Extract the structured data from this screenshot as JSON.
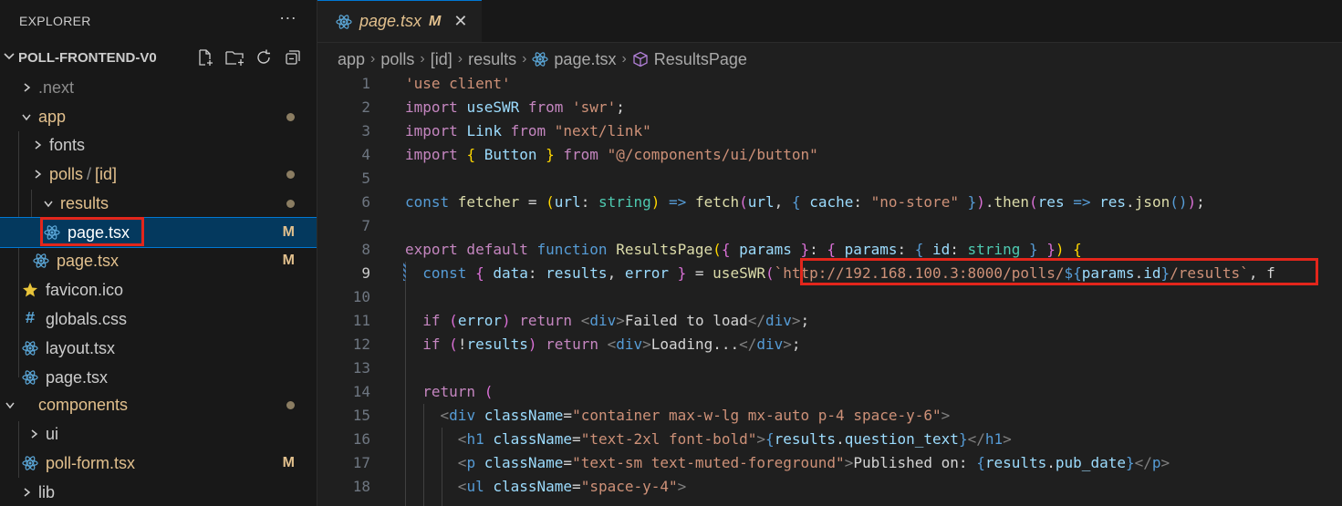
{
  "explorer": {
    "title": "EXPLORER",
    "more": "···",
    "project": "POLL-FRONTEND-V0",
    "tree": [
      {
        "label": ".next",
        "depth": 0,
        "kind": "folder",
        "open": false,
        "status": ""
      },
      {
        "label": "app",
        "depth": 0,
        "kind": "folder",
        "open": true,
        "status": "dot"
      },
      {
        "label": "fonts",
        "depth": 1,
        "kind": "folder",
        "open": false,
        "status": ""
      },
      {
        "label": "polls",
        "label2": "[id]",
        "depth": 1,
        "kind": "folder",
        "open": false,
        "status": "dot"
      },
      {
        "label": "results",
        "depth": 2,
        "kind": "folder",
        "open": true,
        "status": "dot"
      },
      {
        "label": "page.tsx",
        "depth": 3,
        "kind": "react",
        "status": "M",
        "selected": true
      },
      {
        "label": "page.tsx",
        "depth": 2,
        "kind": "react",
        "status": "M"
      },
      {
        "label": "favicon.ico",
        "depth": 1,
        "kind": "star",
        "status": ""
      },
      {
        "label": "globals.css",
        "depth": 1,
        "kind": "hash",
        "status": ""
      },
      {
        "label": "layout.tsx",
        "depth": 1,
        "kind": "react",
        "status": ""
      },
      {
        "label": "page.tsx",
        "depth": 1,
        "kind": "react",
        "status": ""
      },
      {
        "label": "components",
        "depth": 0,
        "kind": "folder",
        "open": true,
        "status": "dot"
      },
      {
        "label": "ui",
        "depth": 1,
        "kind": "folder",
        "open": false,
        "status": ""
      },
      {
        "label": "poll-form.tsx",
        "depth": 1,
        "kind": "react",
        "status": "M"
      },
      {
        "label": "lib",
        "depth": 0,
        "kind": "folder",
        "open": false,
        "status": ""
      }
    ]
  },
  "tab": {
    "label": "page.tsx",
    "modified": "M",
    "close": "✕"
  },
  "breadcrumb": [
    "app",
    "polls",
    "[id]",
    "results",
    "page.tsx",
    "ResultsPage"
  ],
  "code": {
    "current_line": 9,
    "lines": [
      [
        [
          "s",
          "'use client'"
        ]
      ],
      [
        [
          "k",
          "import "
        ],
        [
          "v",
          "useSWR"
        ],
        [
          "k",
          " from "
        ],
        [
          "s",
          "'swr'"
        ],
        [
          "p",
          ";"
        ]
      ],
      [
        [
          "k",
          "import "
        ],
        [
          "v",
          "Link"
        ],
        [
          "k",
          " from "
        ],
        [
          "s",
          "\"next/link\""
        ]
      ],
      [
        [
          "k",
          "import "
        ],
        [
          "y",
          "{ "
        ],
        [
          "v",
          "Button"
        ],
        [
          "y",
          " }"
        ],
        [
          "k",
          " from "
        ],
        [
          "s",
          "\"@/components/ui/button\""
        ]
      ],
      [],
      [
        [
          "b",
          "const "
        ],
        [
          "f",
          "fetcher"
        ],
        [
          "p",
          " = "
        ],
        [
          "y",
          "("
        ],
        [
          "v",
          "url"
        ],
        [
          "p",
          ": "
        ],
        [
          "t",
          "string"
        ],
        [
          "y",
          ")"
        ],
        [
          "p",
          " "
        ],
        [
          "b",
          "=>"
        ],
        [
          "p",
          " "
        ],
        [
          "f",
          "fetch"
        ],
        [
          "m",
          "("
        ],
        [
          "v",
          "url"
        ],
        [
          "p",
          ", "
        ],
        [
          "b",
          "{ "
        ],
        [
          "v",
          "cache"
        ],
        [
          "p",
          ": "
        ],
        [
          "s",
          "\"no-store\""
        ],
        [
          "b",
          " }"
        ],
        [
          "m",
          ")"
        ],
        [
          "p",
          "."
        ],
        [
          "f",
          "then"
        ],
        [
          "m",
          "("
        ],
        [
          "v",
          "res"
        ],
        [
          "p",
          " "
        ],
        [
          "b",
          "=>"
        ],
        [
          "p",
          " "
        ],
        [
          "v",
          "res"
        ],
        [
          "p",
          "."
        ],
        [
          "f",
          "json"
        ],
        [
          "b",
          "()"
        ],
        [
          "m",
          ")"
        ],
        [
          "p",
          ";"
        ]
      ],
      [],
      [
        [
          "k",
          "export default "
        ],
        [
          "b",
          "function "
        ],
        [
          "f",
          "ResultsPage"
        ],
        [
          "y",
          "("
        ],
        [
          "m",
          "{ "
        ],
        [
          "v",
          "params"
        ],
        [
          "m",
          " }"
        ],
        [
          "p",
          ": "
        ],
        [
          "m",
          "{ "
        ],
        [
          "v",
          "params"
        ],
        [
          "p",
          ": "
        ],
        [
          "b",
          "{ "
        ],
        [
          "v",
          "id"
        ],
        [
          "p",
          ": "
        ],
        [
          "t",
          "string"
        ],
        [
          "b",
          " }"
        ],
        [
          "m",
          " }"
        ],
        [
          "y",
          ")"
        ],
        [
          "p",
          " "
        ],
        [
          "y",
          "{"
        ]
      ],
      [
        [
          "p",
          "  "
        ],
        [
          "b",
          "const "
        ],
        [
          "m",
          "{ "
        ],
        [
          "v",
          "data"
        ],
        [
          "p",
          ": "
        ],
        [
          "v",
          "results"
        ],
        [
          "p",
          ", "
        ],
        [
          "v",
          "error"
        ],
        [
          "m",
          " }"
        ],
        [
          "p",
          " = "
        ],
        [
          "f",
          "useSWR"
        ],
        [
          "m",
          "("
        ],
        [
          "s",
          "`http://192.168.100.3:8000/polls/"
        ],
        [
          "b",
          "${"
        ],
        [
          "v",
          "params"
        ],
        [
          "p",
          "."
        ],
        [
          "v",
          "id"
        ],
        [
          "b",
          "}"
        ],
        [
          "s",
          "/results`"
        ],
        [
          "p",
          ", f"
        ]
      ],
      [],
      [
        [
          "p",
          "  "
        ],
        [
          "k",
          "if "
        ],
        [
          "m",
          "("
        ],
        [
          "v",
          "error"
        ],
        [
          "m",
          ")"
        ],
        [
          "k",
          " return "
        ],
        [
          "g",
          "<"
        ],
        [
          "tag",
          "div"
        ],
        [
          "g",
          ">"
        ],
        [
          "p",
          "Failed to load"
        ],
        [
          "g",
          "</"
        ],
        [
          "tag",
          "div"
        ],
        [
          "g",
          ">"
        ],
        [
          "p",
          ";"
        ]
      ],
      [
        [
          "p",
          "  "
        ],
        [
          "k",
          "if "
        ],
        [
          "m",
          "("
        ],
        [
          "p",
          "!"
        ],
        [
          "v",
          "results"
        ],
        [
          "m",
          ")"
        ],
        [
          "k",
          " return "
        ],
        [
          "g",
          "<"
        ],
        [
          "tag",
          "div"
        ],
        [
          "g",
          ">"
        ],
        [
          "p",
          "Loading..."
        ],
        [
          "g",
          "</"
        ],
        [
          "tag",
          "div"
        ],
        [
          "g",
          ">"
        ],
        [
          "p",
          ";"
        ]
      ],
      [],
      [
        [
          "p",
          "  "
        ],
        [
          "k",
          "return "
        ],
        [
          "m",
          "("
        ]
      ],
      [
        [
          "p",
          "    "
        ],
        [
          "g",
          "<"
        ],
        [
          "tag",
          "div"
        ],
        [
          "p",
          " "
        ],
        [
          "attr",
          "className"
        ],
        [
          "p",
          "="
        ],
        [
          "s",
          "\"container max-w-lg mx-auto p-4 space-y-6\""
        ],
        [
          "g",
          ">"
        ]
      ],
      [
        [
          "p",
          "      "
        ],
        [
          "g",
          "<"
        ],
        [
          "tag",
          "h1"
        ],
        [
          "p",
          " "
        ],
        [
          "attr",
          "className"
        ],
        [
          "p",
          "="
        ],
        [
          "s",
          "\"text-2xl font-bold\""
        ],
        [
          "g",
          ">"
        ],
        [
          "b",
          "{"
        ],
        [
          "v",
          "results"
        ],
        [
          "p",
          "."
        ],
        [
          "v",
          "question_text"
        ],
        [
          "b",
          "}"
        ],
        [
          "g",
          "</"
        ],
        [
          "tag",
          "h1"
        ],
        [
          "g",
          ">"
        ]
      ],
      [
        [
          "p",
          "      "
        ],
        [
          "g",
          "<"
        ],
        [
          "tag",
          "p"
        ],
        [
          "p",
          " "
        ],
        [
          "attr",
          "className"
        ],
        [
          "p",
          "="
        ],
        [
          "s",
          "\"text-sm text-muted-foreground\""
        ],
        [
          "g",
          ">"
        ],
        [
          "p",
          "Published on: "
        ],
        [
          "b",
          "{"
        ],
        [
          "v",
          "results"
        ],
        [
          "p",
          "."
        ],
        [
          "v",
          "pub_date"
        ],
        [
          "b",
          "}"
        ],
        [
          "g",
          "</"
        ],
        [
          "tag",
          "p"
        ],
        [
          "g",
          ">"
        ]
      ],
      [
        [
          "p",
          "      "
        ],
        [
          "g",
          "<"
        ],
        [
          "tag",
          "ul"
        ],
        [
          "p",
          " "
        ],
        [
          "attr",
          "className"
        ],
        [
          "p",
          "="
        ],
        [
          "s",
          "\"space-y-4\""
        ],
        [
          "g",
          ">"
        ]
      ]
    ]
  }
}
